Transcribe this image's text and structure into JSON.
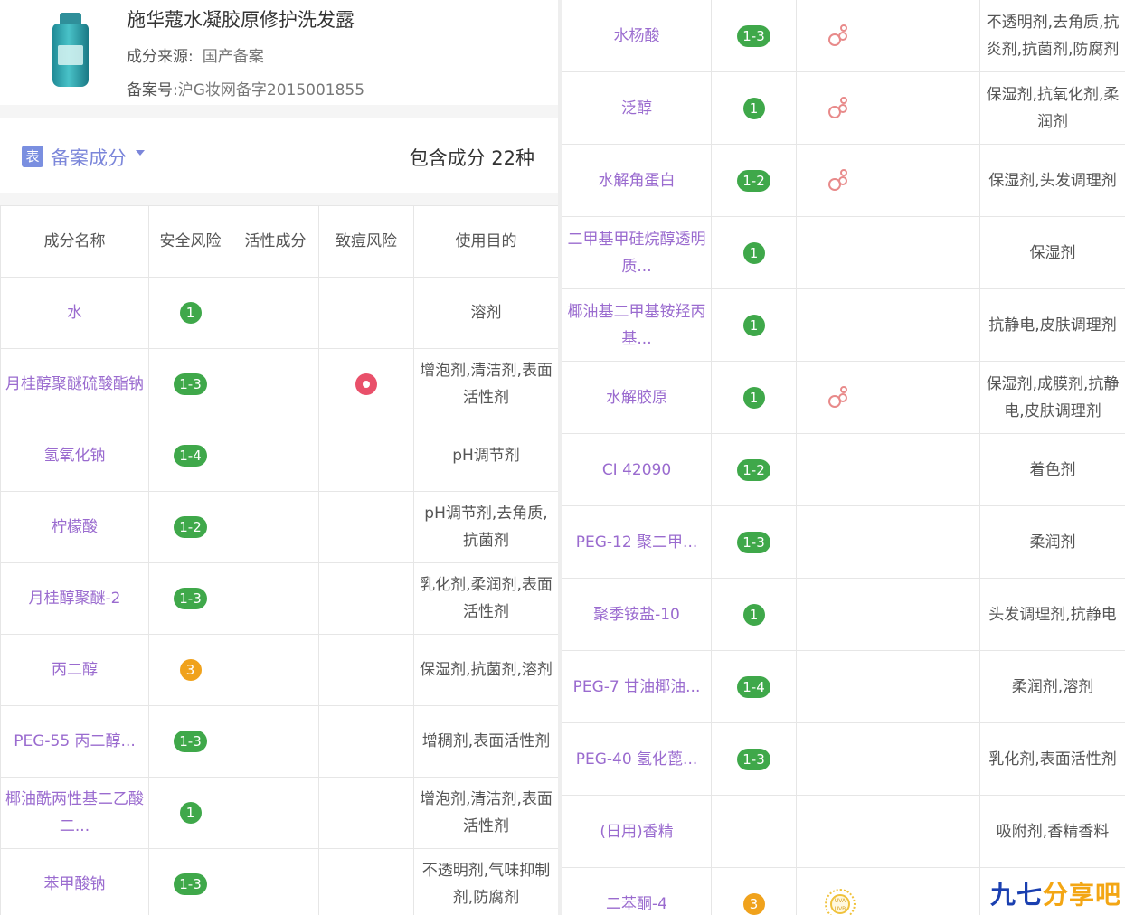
{
  "product": {
    "name": "施华蔻水凝胶原修护洗发露",
    "source_label": "成分来源:",
    "source_value": "国产备案",
    "registration_label": "备案号:",
    "registration_value": "沪G妆网备字2015001855"
  },
  "section": {
    "icon_text": "表",
    "title": "备案成分",
    "count_text": "包含成分 22种"
  },
  "table": {
    "headers": {
      "name": "成分名称",
      "safety": "安全风险",
      "active": "活性成分",
      "acne": "致痘风险",
      "purpose": "使用目的"
    }
  },
  "left_rows": [
    {
      "name": "水",
      "safety": "1",
      "purpose": "溶剂"
    },
    {
      "name": "月桂醇聚醚硫酸酯钠",
      "safety": "1-3",
      "acne": true,
      "purpose": "增泡剂,清洁剂,表面活性剂"
    },
    {
      "name": "氢氧化钠",
      "safety": "1-4",
      "purpose": "pH调节剂"
    },
    {
      "name": "柠檬酸",
      "safety": "1-2",
      "purpose": "pH调节剂,去角质,抗菌剂"
    },
    {
      "name": "月桂醇聚醚-2",
      "safety": "1-3",
      "purpose": "乳化剂,柔润剂,表面活性剂"
    },
    {
      "name": "丙二醇",
      "safety": "3",
      "safety_color": "orange",
      "purpose": "保湿剂,抗菌剂,溶剂"
    },
    {
      "name": "PEG-55 丙二醇...",
      "safety": "1-3",
      "purpose": "增稠剂,表面活性剂"
    },
    {
      "name": "椰油酰两性基二乙酸二...",
      "safety": "1",
      "purpose": "增泡剂,清洁剂,表面活性剂"
    },
    {
      "name": "苯甲酸钠",
      "safety": "1-3",
      "purpose": "不透明剂,气味抑制剂,防腐剂"
    }
  ],
  "right_rows": [
    {
      "name": "水杨酸",
      "safety": "1-3",
      "active": true,
      "purpose": "不透明剂,去角质,抗炎剂,抗菌剂,防腐剂"
    },
    {
      "name": "泛醇",
      "safety": "1",
      "active": true,
      "purpose": "保湿剂,抗氧化剂,柔润剂"
    },
    {
      "name": "水解角蛋白",
      "safety": "1-2",
      "active": true,
      "purpose": "保湿剂,头发调理剂"
    },
    {
      "name": "二甲基甲硅烷醇透明质...",
      "safety": "1",
      "purpose": "保湿剂"
    },
    {
      "name": "椰油基二甲基铵羟丙基...",
      "safety": "1",
      "purpose": "抗静电,皮肤调理剂"
    },
    {
      "name": "水解胶原",
      "safety": "1",
      "active": true,
      "purpose": "保湿剂,成膜剂,抗静电,皮肤调理剂"
    },
    {
      "name": "CI 42090",
      "safety": "1-2",
      "purpose": "着色剂"
    },
    {
      "name": "PEG-12 聚二甲...",
      "safety": "1-3",
      "purpose": "柔润剂"
    },
    {
      "name": "聚季铵盐-10",
      "safety": "1",
      "purpose": "头发调理剂,抗静电"
    },
    {
      "name": "PEG-7 甘油椰油...",
      "safety": "1-4",
      "purpose": "柔润剂,溶剂"
    },
    {
      "name": "PEG-40 氢化蓖...",
      "safety": "1-3",
      "purpose": "乳化剂,表面活性剂"
    },
    {
      "name": "(日用)香精",
      "safety": "",
      "purpose": "吸附剂,香精香料"
    },
    {
      "name": "二苯酮-4",
      "safety": "3",
      "safety_color": "orange",
      "sunscreen": true,
      "sunscreen_text": "UVA UVB",
      "purpose": ""
    }
  ],
  "watermark": {
    "part1": "九七",
    "part2": "分享吧"
  },
  "colors": {
    "ingredient_name": "#9a6bcf",
    "safe_green": "#3fa84a",
    "warn_orange": "#f0a21c",
    "acne_red": "#e9506a",
    "section_accent": "#7b86da"
  }
}
